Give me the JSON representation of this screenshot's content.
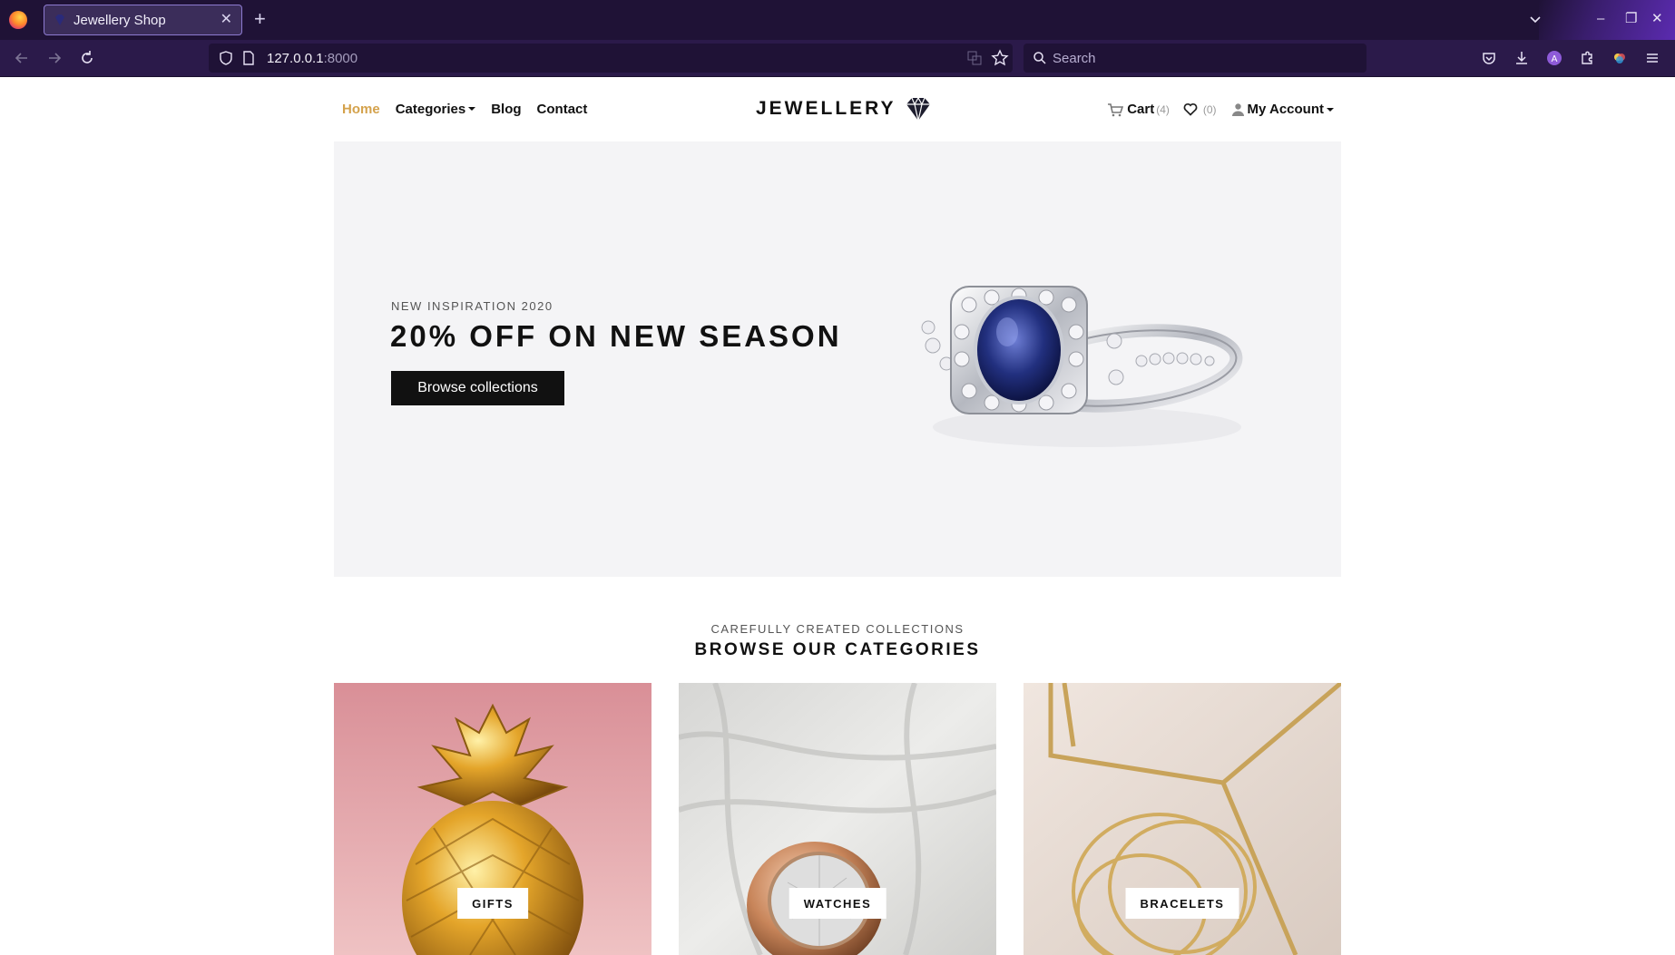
{
  "browser": {
    "tab_title": "Jewellery Shop",
    "url_host": "127.0.0.1",
    "url_port": ":8000",
    "search_placeholder": "Search"
  },
  "header": {
    "menu": [
      {
        "label": "Home",
        "active": true
      },
      {
        "label": "Categories"
      },
      {
        "label": "Blog"
      },
      {
        "label": "Contact"
      }
    ],
    "brand": "JEWELLERY",
    "cart_label": "Cart",
    "cart_count": "(4)",
    "wishlist_count": "(0)",
    "account_label": "My Account"
  },
  "hero": {
    "eyebrow": "NEW INSPIRATION 2020",
    "headline": "20% OFF ON NEW SEASON",
    "cta": "Browse collections"
  },
  "categories_section": {
    "subtitle": "CAREFULLY CREATED COLLECTIONS",
    "title": "BROWSE OUR CATEGORIES",
    "items": [
      {
        "label": "GIFTS"
      },
      {
        "label": "WATCHES"
      },
      {
        "label": "BRACELETS"
      }
    ]
  },
  "colors": {
    "accent": "#d4a24c",
    "browser_bg": "#2b1a4a"
  }
}
